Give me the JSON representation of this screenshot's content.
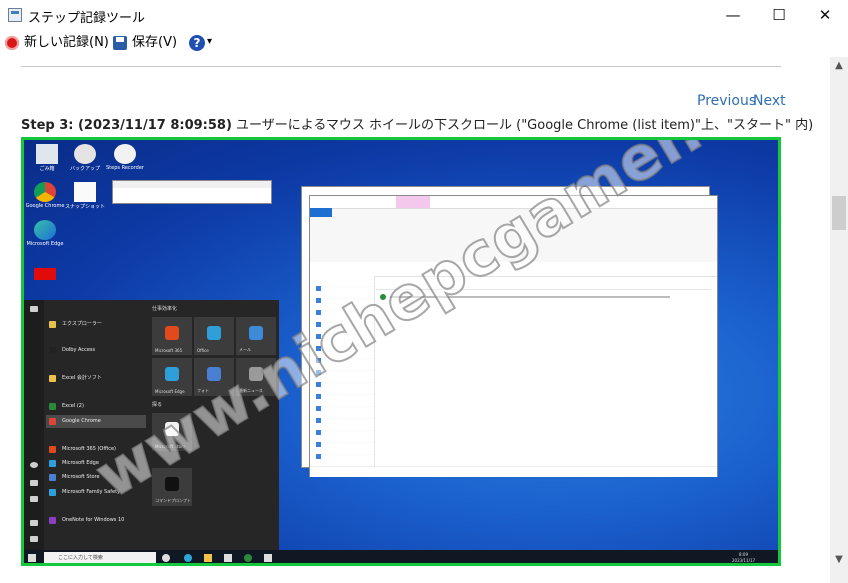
{
  "window": {
    "title": "ステップ記録ツール",
    "minimize": "—",
    "maximize": "☐",
    "close": "✕"
  },
  "toolbar": {
    "new_record": "新しい記録(N)",
    "save": "保存(V)",
    "help_glyph": "?",
    "help_arrow": "▾"
  },
  "nav": {
    "previous": "Previous",
    "next": "Next"
  },
  "step": {
    "label": "Step 3: (2023/11/17 8:09:58)",
    "description": " ユーザーによるマウス ホイールの下スクロール (\"Google Chrome (list item)\"上、\"スタート\" 内)"
  },
  "screenshot": {
    "desktop_icons": [
      "ごみ箱",
      "バックアップ",
      "Steps Recorder",
      "Google Chrome",
      "スナップショット",
      "Microsoft Edge"
    ],
    "start_menu_apps": [
      "エクスプローラー",
      "Dolby Access",
      "Excel 会計ソフト",
      "Excel (2)",
      "Google Chrome",
      "Microsoft 365 (Office)",
      "Microsoft Edge",
      "Microsoft Store",
      "Microsoft Family Safety",
      "OneNote for Windows 10"
    ],
    "tile_group_label": "仕事効率化",
    "tile_group_label2": "探る",
    "tiles": [
      "Microsoft 365",
      "Office",
      "メール",
      "Microsoft Edge",
      "フォト",
      "最新ニュース",
      "Microsoft Store",
      "コマンドプロンプト"
    ],
    "taskbar_search": "ここに入力して検索",
    "clock_time": "8:09",
    "clock_date": "2023/11/17"
  },
  "watermark": "www.nichepcgamer.com",
  "colors": {
    "border_highlight": "#14c73d",
    "link": "#2f6fb3",
    "record": "#d81818"
  }
}
